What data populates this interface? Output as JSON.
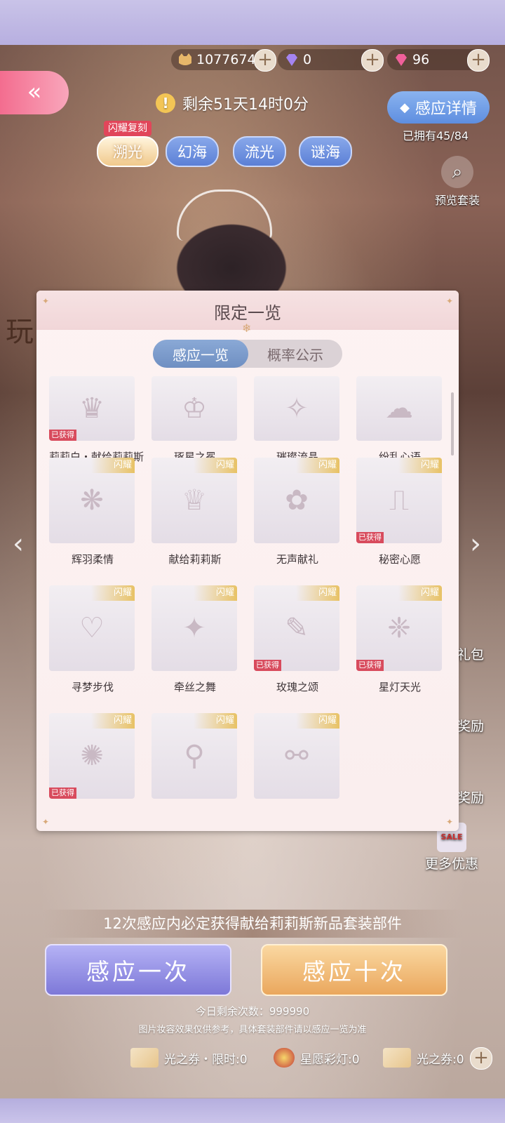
{
  "currency": {
    "coins": "1077674",
    "diamonds": "0",
    "stars": "96",
    "colors": {
      "coin": "#e7b76a",
      "diamond": "#a484f0",
      "star": "#f0609a"
    }
  },
  "header": {
    "back_icon": "double-left-chevron-icon",
    "timer_text": "剩余51天14时0分",
    "detail_button": "感应详情",
    "owned_text": "已拥有45/84",
    "preview_label": "预览套装"
  },
  "pools": {
    "badge": "闪耀复刻",
    "tabs": [
      {
        "label": "溯光",
        "active": true
      },
      {
        "label": "幻海",
        "active": false
      },
      {
        "label": "流光",
        "active": false
      },
      {
        "label": "谜海",
        "active": false
      }
    ]
  },
  "panel": {
    "title": "限定一览",
    "segments": [
      {
        "label": "感应一览",
        "active": true
      },
      {
        "label": "概率公示",
        "active": false
      }
    ],
    "items": [
      {
        "name": "莉莉白・献给莉莉斯",
        "owned_badge": "已获得",
        "flash_badge": ""
      },
      {
        "name": "琢星之冕",
        "owned_badge": "",
        "flash_badge": ""
      },
      {
        "name": "璀璨流晶",
        "owned_badge": "",
        "flash_badge": ""
      },
      {
        "name": "纷乱心语",
        "owned_badge": "",
        "flash_badge": ""
      },
      {
        "name": "辉羽柔情",
        "owned_badge": "",
        "flash_badge": "闪耀"
      },
      {
        "name": "献给莉莉斯",
        "owned_badge": "",
        "flash_badge": "闪耀"
      },
      {
        "name": "无声献礼",
        "owned_badge": "",
        "flash_badge": "闪耀"
      },
      {
        "name": "秘密心愿",
        "owned_badge": "已获得",
        "flash_badge": "闪耀"
      },
      {
        "name": "寻梦步伐",
        "owned_badge": "",
        "flash_badge": "闪耀"
      },
      {
        "name": "牵丝之舞",
        "owned_badge": "",
        "flash_badge": "闪耀"
      },
      {
        "name": "玫瑰之颂",
        "owned_badge": "已获得",
        "flash_badge": "闪耀"
      },
      {
        "name": "星灯天光",
        "owned_badge": "已获得",
        "flash_badge": "闪耀"
      },
      {
        "name": "",
        "owned_badge": "已获得",
        "flash_badge": "闪耀"
      },
      {
        "name": "",
        "owned_badge": "",
        "flash_badge": "闪耀"
      },
      {
        "name": "",
        "owned_badge": "",
        "flash_badge": "闪耀"
      }
    ]
  },
  "side": {
    "gift_label": "礼包",
    "reward_label_1": "奖励",
    "reward_label_2": "奖励",
    "more_offers": "更多优惠",
    "sale_badge": "SALE",
    "left_partial": "玩"
  },
  "guarantee_text": "12次感应内必定获得献给莉莉斯新品套装部件",
  "actions": {
    "draw_once": "感应一次",
    "draw_ten": "感应十次",
    "remaining": "今日剩余次数：999990",
    "disclaimer": "图片妆容效果仅供参考，具体套装部件请以感应一览为准"
  },
  "tickets": [
    {
      "label": "光之券・限时:0"
    },
    {
      "label": "星愿彩灯:0"
    },
    {
      "label": "光之券:0"
    }
  ]
}
